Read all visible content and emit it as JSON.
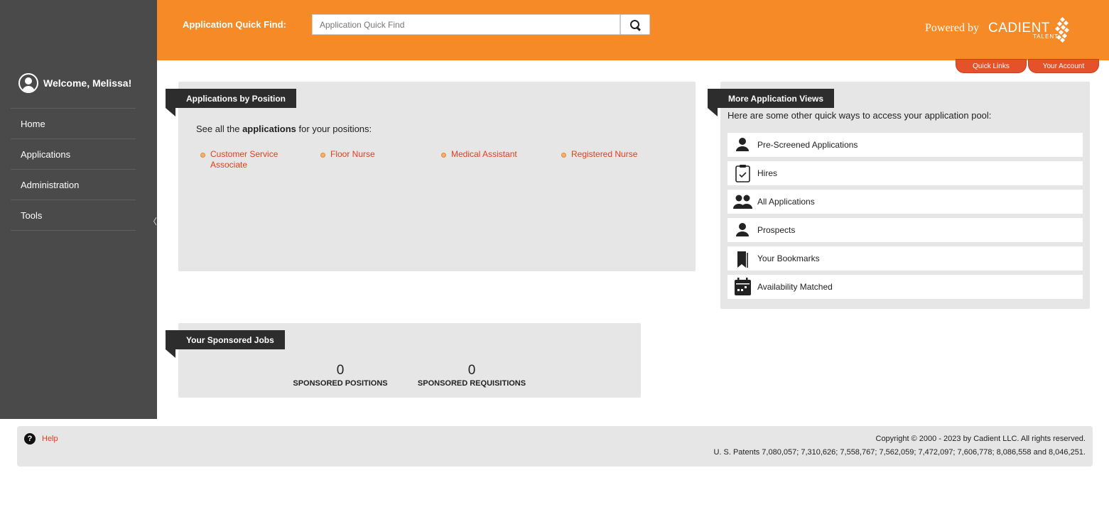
{
  "header": {
    "quick_find_label": "Application Quick Find:",
    "quick_find_placeholder": "Application Quick Find",
    "powered_by": "Powered by",
    "brand_name": "CADIENT",
    "brand_sub": "TALENT",
    "quick_links": "Quick Links",
    "your_account": "Your Account",
    "accent_color": "#f58a27"
  },
  "sidebar": {
    "welcome": "Welcome, Melissa!",
    "items": [
      {
        "label": "Home"
      },
      {
        "label": "Applications"
      },
      {
        "label": "Administration"
      },
      {
        "label": "Tools"
      }
    ],
    "collapse_glyph": "〈"
  },
  "positions_panel": {
    "title": "Applications by Position",
    "intro_prefix": "See all the",
    "intro_bold": "applications",
    "intro_suffix": "for your positions:",
    "positions": [
      "Customer Service Associate",
      "Floor Nurse",
      "Medical Assistant",
      "Registered Nurse"
    ]
  },
  "views_panel": {
    "title": "More Application Views",
    "intro": "Here are some other quick ways to access your application pool:",
    "items": [
      {
        "label": "Pre-Screened Applications",
        "icon": "person-icon"
      },
      {
        "label": "Hires",
        "icon": "clipboard-check-icon"
      },
      {
        "label": "All Applications",
        "icon": "people-icon"
      },
      {
        "label": "Prospects",
        "icon": "person-icon"
      },
      {
        "label": "Your Bookmarks",
        "icon": "bookmarks-icon"
      },
      {
        "label": "Availability Matched",
        "icon": "calendar-icon"
      }
    ]
  },
  "sponsored_panel": {
    "title": "Your Sponsored Jobs",
    "positions_count": "0",
    "positions_label": "SPONSORED POSITIONS",
    "requisitions_count": "0",
    "requisitions_label": "SPONSORED REQUISITIONS"
  },
  "footer": {
    "help": "Help",
    "copyright": "Copyright © 2000 - 2023 by Cadient LLC. All rights reserved.",
    "patents": "U. S. Patents 7,080,057; 7,310,626; 7,558,767; 7,562,059; 7,472,097; 7,606,778; 8,086,558 and 8,046,251."
  }
}
